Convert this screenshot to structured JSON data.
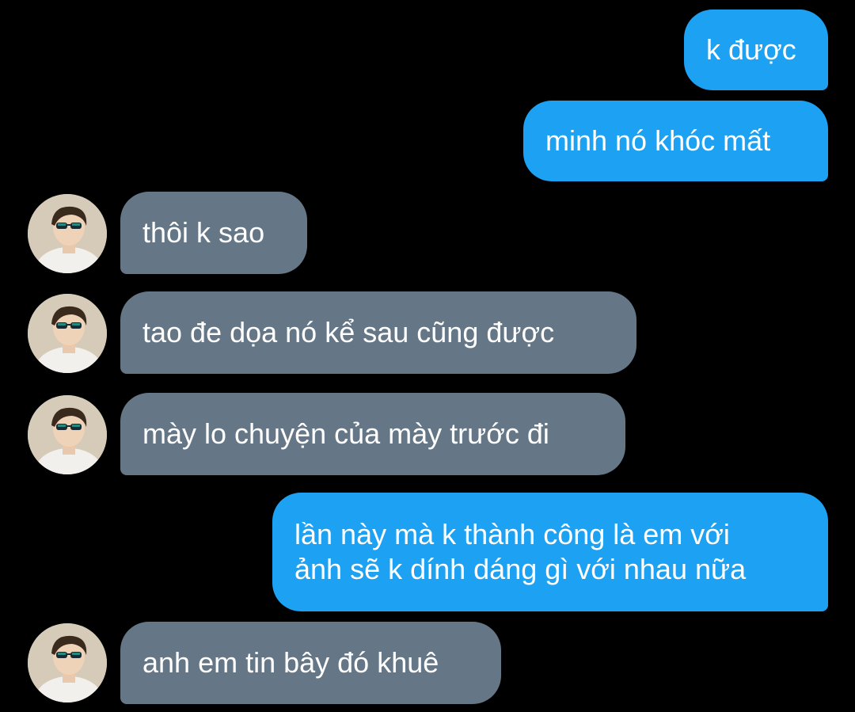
{
  "messages": [
    {
      "direction": "outgoing",
      "text": "k được"
    },
    {
      "direction": "outgoing",
      "text": "minh nó khóc mất"
    },
    {
      "direction": "incoming",
      "text": "thôi k sao",
      "avatar": "user-avatar-sunglasses"
    },
    {
      "direction": "incoming",
      "text": "tao đe dọa nó kể sau cũng được",
      "avatar": "user-avatar-sunglasses"
    },
    {
      "direction": "incoming",
      "text": "mày lo chuyện của mày trước đi",
      "avatar": "user-avatar-sunglasses"
    },
    {
      "direction": "outgoing",
      "text": "lần này mà k thành công là em với\nảnh sẽ k dính dáng gì với nhau nữa"
    },
    {
      "direction": "incoming",
      "text": "anh em tin bây đó khuê",
      "avatar": "user-avatar-sunglasses"
    }
  ],
  "colors": {
    "background": "#000000",
    "outgoing_bubble": "#1da1f2",
    "incoming_bubble": "#657786",
    "text": "#ffffff"
  }
}
